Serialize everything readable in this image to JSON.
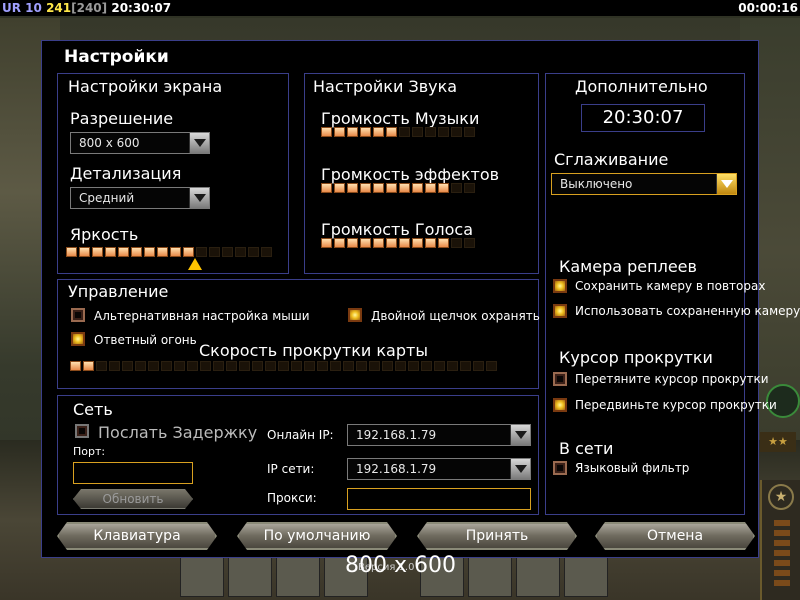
{
  "topbar": {
    "ur": "UR",
    "ur_value": "10",
    "fps": "241",
    "fps_bracket": "[240]",
    "clock": "20:30:07",
    "elapsed": "00:00:16"
  },
  "dialog": {
    "title": "Настройки"
  },
  "screen": {
    "title": "Настройки экрана",
    "resolution_label": "Разрешение",
    "resolution_value": "800 x 600",
    "detail_label": "Детализация",
    "detail_value": "Средний",
    "brightness_label": "Яркость",
    "brightness_level": 0.65
  },
  "sound": {
    "title": "Настройки Звука",
    "music_label": "Громкость Музыки",
    "music_level": 0.5,
    "effects_label": "Громкость эффектов",
    "effects_level": 0.83,
    "voice_label": "Громкость Голоса",
    "voice_level": 0.83
  },
  "extra": {
    "title": "Дополнительно",
    "clock": "20:30:07",
    "aa_label": "Сглаживание",
    "aa_value": "Выключено",
    "replay_cam_title": "Камера реплеев",
    "save_cam_label": "Сохранить камеру в повторах",
    "save_cam_checked": true,
    "use_cam_label": "Использовать сохраненную камеру",
    "use_cam_checked": true,
    "scroll_cursor_title": "Курсор прокрутки",
    "drag_cursor_label": "Перетяните курсор прокрутки",
    "drag_cursor_checked": false,
    "move_cursor_label": "Передвиньте курсор прокрутки",
    "move_cursor_checked": true,
    "online_title": "В сети",
    "lang_filter_label": "Языковый фильтр",
    "lang_filter_checked": false
  },
  "controls": {
    "title": "Управление",
    "alt_mouse_label": "Альтернативная настройка мыши",
    "alt_mouse_checked": false,
    "double_click_label": "Двойной щелчок охранять",
    "double_click_checked": true,
    "return_fire_label": "Ответный огонь",
    "return_fire_checked": true,
    "scroll_speed_label": "Скорость прокрутки карты",
    "scroll_speed_level": 0.07
  },
  "network": {
    "title": "Сеть",
    "send_delay_label": "Послать Задержку",
    "port_label": "Порт:",
    "port_value": "",
    "update_label": "Обновить",
    "online_ip_label": "Онлайн IP:",
    "online_ip_value": "192.168.1.79",
    "lan_ip_label": "IP сети:",
    "lan_ip_value": "192.168.1.79",
    "proxy_label": "Прокси:",
    "proxy_value": ""
  },
  "buttons": {
    "keyboard": "Клавиатура",
    "defaults": "По умолчанию",
    "accept": "Принять",
    "cancel": "Отмена"
  },
  "overlay": {
    "resolution": "800 x 600",
    "version_hint": "Версия 1.0"
  },
  "colors": {
    "accent_gold": "#d8a020",
    "panel_border": "#3a3e8a",
    "slider_on": "#e88a4a"
  }
}
